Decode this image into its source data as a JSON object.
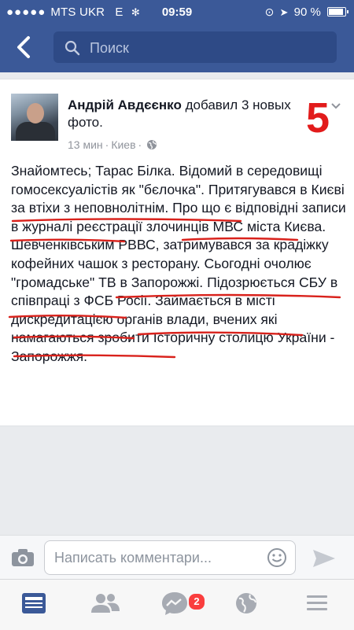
{
  "status_bar": {
    "signal_dots": "●●●●●",
    "carrier": "MTS UKR",
    "network": "E",
    "time": "09:59",
    "battery_text": "90 %",
    "battery_level": 0.9
  },
  "nav": {
    "search_placeholder": "Поиск"
  },
  "post": {
    "author": "Андрій Авдєєнко",
    "action": "добавил 3 новых фото.",
    "time": "13 мин",
    "location": "Киев",
    "annotation": "5",
    "text": "Знайомтесь; Тарас Білка. Відомий в середовищі гомосексуалістів як \"бєлочка\". Притягувався в Києві за втіхи з неповнолітнім. Про що є відповідні записи в журналі реєстрації злочинців МВС міста Києва. Шевченківським РВВС, затримувався за крадіжку кофейних чашок з ресторану. Сьогодні очолює \"громадське\" ТВ в Запорожжі. Підозрюється СБУ в співпраці з ФСБ Росії. Займається в місті дискредитацією органів влади, вчених які намагаються зробити Історичну столицю України - Запорожжя."
  },
  "comment": {
    "placeholder": "Написать комментари..."
  },
  "tabbar": {
    "messages_badge": "2"
  },
  "colors": {
    "brand": "#3b5998",
    "annotation": "#e21b1b",
    "underline": "#d9221c"
  }
}
